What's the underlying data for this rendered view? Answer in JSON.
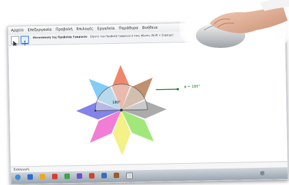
{
  "menubar": {
    "items": [
      "Αρχείο",
      "Επεξεργασία",
      "Προβολή",
      "Επιλογές",
      "Εργαλεία",
      "Παράθυρα",
      "Βοήθεια"
    ]
  },
  "toolbar": {
    "tool_name": "Μετατόπιση της Προβολής Γραφικών",
    "tool_hint": "Σύρετε την Προβολή Γραφικών ή τους άξονες (Shift + Σύρσιμο)"
  },
  "canvas": {
    "angle_label": "180°",
    "slider_label": "φ = 180°",
    "petal_colors": [
      "#ee7a5a",
      "#b9855e",
      "#a2a2a2",
      "#98e46c",
      "#f2f07a",
      "#f06fd3",
      "#7575e8",
      "#75c7f5"
    ]
  },
  "inputbar": {
    "label": "Εισαγωγή:"
  }
}
